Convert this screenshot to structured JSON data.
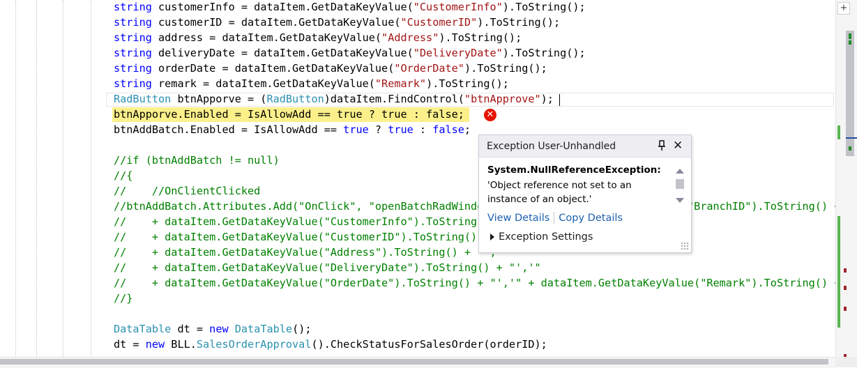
{
  "popup": {
    "title": "Exception User-Unhandled",
    "exception_type": "System.NullReferenceException:",
    "message": "'Object reference not set to an instance of an object.'",
    "view_details": "View Details",
    "copy_details": "Copy Details",
    "exception_settings": "Exception Settings"
  },
  "icons": {
    "error": "error-circle-icon",
    "pin": "pin-icon",
    "close": "close-icon"
  },
  "colors": {
    "keyword": "#0000ff",
    "type": "#2b91af",
    "string": "#a31515",
    "comment": "#008000",
    "highlight": "#fbf08a",
    "error": "#e51400",
    "link": "#1e61b0"
  },
  "code_lines": [
    [
      [
        "kw",
        "string"
      ],
      [
        "tx",
        " customerInfo = dataItem.GetDataKeyValue("
      ],
      [
        "st",
        "\"CustomerInfo\""
      ],
      [
        "tx",
        ").ToString();"
      ]
    ],
    [
      [
        "kw",
        "string"
      ],
      [
        "tx",
        " customerID = dataItem.GetDataKeyValue("
      ],
      [
        "st",
        "\"CustomerID\""
      ],
      [
        "tx",
        ").ToString();"
      ]
    ],
    [
      [
        "kw",
        "string"
      ],
      [
        "tx",
        " address = dataItem.GetDataKeyValue("
      ],
      [
        "st",
        "\"Address\""
      ],
      [
        "tx",
        ").ToString();"
      ]
    ],
    [
      [
        "kw",
        "string"
      ],
      [
        "tx",
        " deliveryDate = dataItem.GetDataKeyValue("
      ],
      [
        "st",
        "\"DeliveryDate\""
      ],
      [
        "tx",
        ").ToString();"
      ]
    ],
    [
      [
        "kw",
        "string"
      ],
      [
        "tx",
        " orderDate = dataItem.GetDataKeyValue("
      ],
      [
        "st",
        "\"OrderDate\""
      ],
      [
        "tx",
        ").ToString();"
      ]
    ],
    [
      [
        "kw",
        "string"
      ],
      [
        "tx",
        " remark = dataItem.GetDataKeyValue("
      ],
      [
        "st",
        "\"Remark\""
      ],
      [
        "tx",
        ").ToString();"
      ]
    ],
    [
      [
        "ty",
        "RadButton"
      ],
      [
        "tx",
        " btnApporve = ("
      ],
      [
        "ty",
        "RadButton"
      ],
      [
        "tx",
        ")dataItem.FindControl("
      ],
      [
        "st",
        "\"btnApprove\""
      ],
      [
        "tx",
        ");"
      ]
    ],
    [
      [
        "tx",
        "btnApporve.Enabled = IsAllowAdd == true ? true : false;"
      ]
    ],
    [
      [
        "tx",
        "btnAddBatch.Enabled = IsAllowAdd == "
      ],
      [
        "kw",
        "true"
      ],
      [
        "tx",
        " ? "
      ],
      [
        "kw",
        "true"
      ],
      [
        "tx",
        " : "
      ],
      [
        "kw",
        "false"
      ],
      [
        "tx",
        ";"
      ]
    ],
    [],
    [
      [
        "cm",
        "//if (btnAddBatch != null)"
      ]
    ],
    [
      [
        "cm",
        "//{"
      ]
    ],
    [
      [
        "cm",
        "//    //OnClientClicked"
      ]
    ],
    [
      [
        "cm",
        "//btnAddBatch.Attributes.Add(\"OnClick\", \"openBatchRadWindow('\" + dataItem.GetDataKeyValue(\"BranchID\").ToString() + \"','\""
      ]
    ],
    [
      [
        "cm",
        "//    + dataItem.GetDataKeyValue(\"CustomerInfo\").ToString() + \"','\""
      ]
    ],
    [
      [
        "cm",
        "//    + dataItem.GetDataKeyValue(\"CustomerID\").ToString() + \"','\""
      ]
    ],
    [
      [
        "cm",
        "//    + dataItem.GetDataKeyValue(\"Address\").ToString() + \"','\""
      ]
    ],
    [
      [
        "cm",
        "//    + dataItem.GetDataKeyValue(\"DeliveryDate\").ToString() + \"','\""
      ]
    ],
    [
      [
        "cm",
        "//    + dataItem.GetDataKeyValue(\"OrderDate\").ToString() + \"','\" + dataItem.GetDataKeyValue(\"Remark\").ToString() + \"')\");"
      ]
    ],
    [
      [
        "cm",
        "//}"
      ]
    ],
    [],
    [
      [
        "ty",
        "DataTable"
      ],
      [
        "tx",
        " dt = "
      ],
      [
        "kw",
        "new"
      ],
      [
        "tx",
        " "
      ],
      [
        "ty",
        "DataTable"
      ],
      [
        "tx",
        "();"
      ]
    ],
    [
      [
        "tx",
        "dt = "
      ],
      [
        "kw",
        "new"
      ],
      [
        "tx",
        " BLL."
      ],
      [
        "ty",
        "SalesOrderApproval"
      ],
      [
        "tx",
        "().CheckStatusForSalesOrder(orderID);"
      ]
    ]
  ]
}
